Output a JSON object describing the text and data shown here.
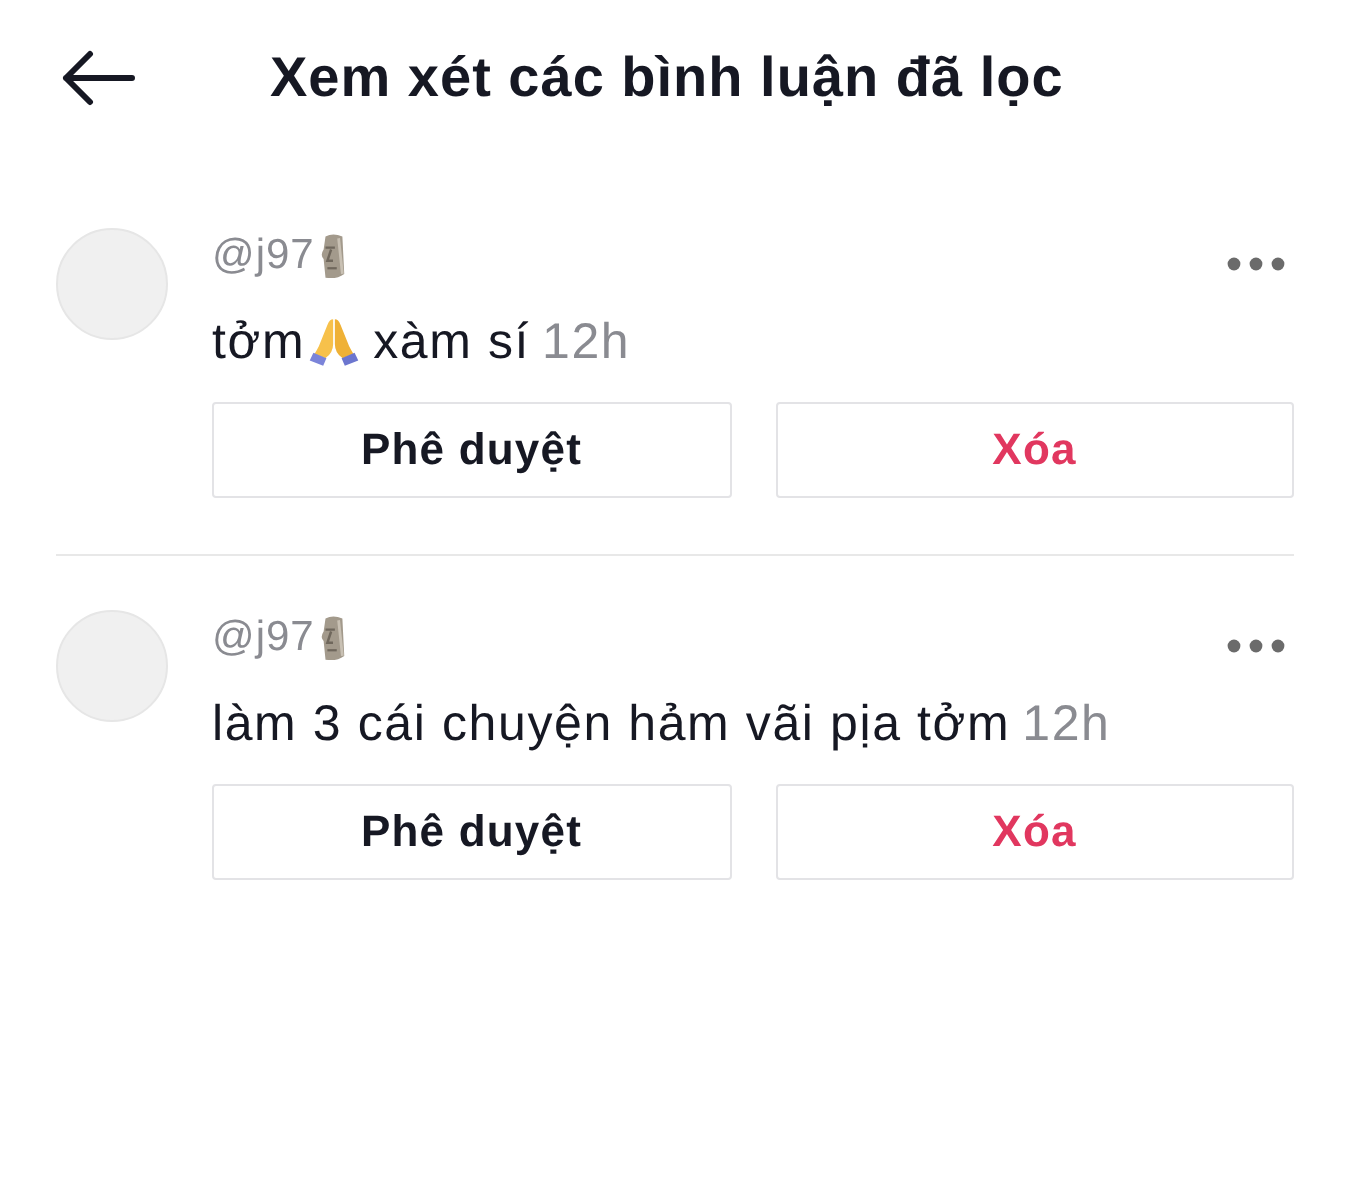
{
  "header": {
    "title": "Xem xét các bình luận đã lọc"
  },
  "comments": [
    {
      "username": "@j97",
      "text_parts": [
        "tởm",
        "xàm sí"
      ],
      "time": "12h",
      "actions": [
        {
          "label": "Phê duyệt",
          "kind": "approve"
        },
        {
          "label": "Xóa",
          "kind": "delete"
        }
      ]
    },
    {
      "username": "@j97",
      "text_parts": [
        "làm 3 cái chuyện hảm vãi pịa tởm"
      ],
      "time": "12h",
      "actions": [
        {
          "label": "Phê duyệt",
          "kind": "approve"
        },
        {
          "label": "Xóa",
          "kind": "delete"
        }
      ]
    }
  ]
}
